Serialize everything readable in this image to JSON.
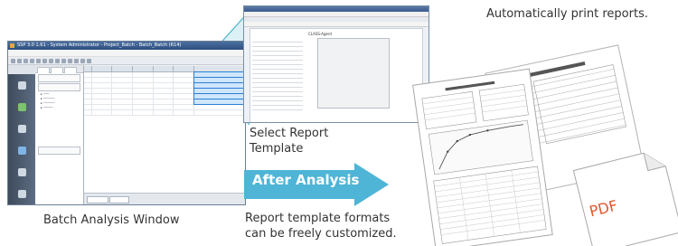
{
  "captions": {
    "top_right": "Automatically print reports.",
    "select_template": [
      "Select Report",
      "Template"
    ],
    "batch_window": "Batch Analysis Window",
    "customize": [
      "Report template formats",
      "can be freely customized."
    ]
  },
  "arrow": {
    "label": "After Analysis",
    "color": "#4fb5d6"
  },
  "pdf": {
    "label": "PDF",
    "color": "#e4572e"
  },
  "accent_color": "#53b8c9",
  "batch_window": {
    "title": "SSP 3.0 1.61 - System Administrator - Project_Batch - Batch_Batch (R14)"
  },
  "report_template": {
    "page_title": "CLASS-Agent"
  }
}
